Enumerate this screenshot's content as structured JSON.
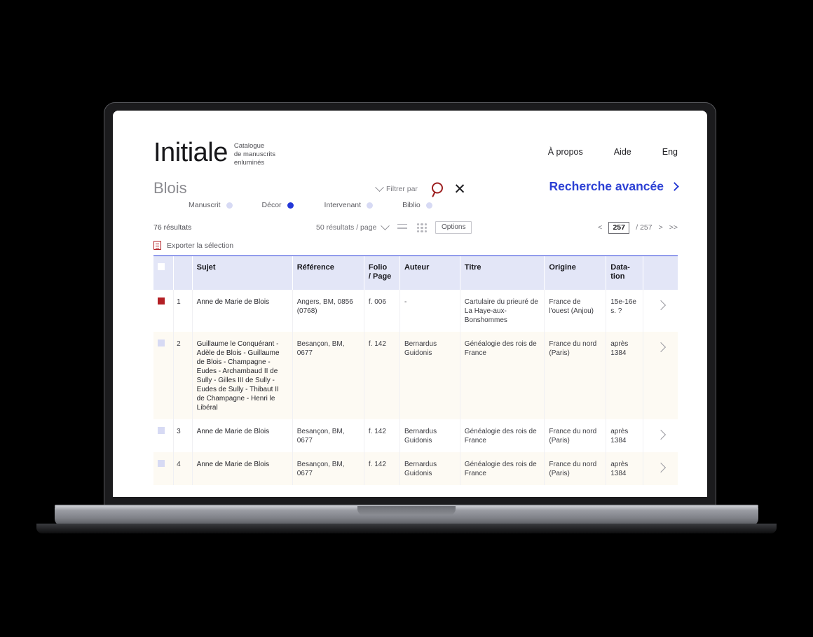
{
  "brand": {
    "name": "Initiale",
    "subtitle_line1": "Catalogue",
    "subtitle_line2": "de manuscrits",
    "subtitle_line3": "enluminés"
  },
  "top_nav": [
    {
      "label": "À propos"
    },
    {
      "label": "Aide"
    },
    {
      "label": "Eng"
    }
  ],
  "search": {
    "query": "Blois",
    "filter_label": "Filtrer par",
    "search_icon": "search-icon",
    "close_icon": "close-icon",
    "advanced_label": "Recherche avancée",
    "advanced_chevron": "chevron-right-icon"
  },
  "facets": [
    {
      "label": "Manuscrit",
      "active": false
    },
    {
      "label": "Décor",
      "active": true
    },
    {
      "label": "Intervenant",
      "active": false
    },
    {
      "label": "Biblio",
      "active": false
    }
  ],
  "toolbar": {
    "result_count": "76 résultats",
    "per_page": "50 résultats / page",
    "per_page_chevron": "chevron-down-icon",
    "list_view_icon": "list-view-icon",
    "grid_view_icon": "grid-view-icon",
    "options_label": "Options",
    "export_label": "Exporter la sélection",
    "export_icon": "export-document-icon"
  },
  "pagination": {
    "prev": "<",
    "current_page": "257",
    "separator": "/ 257",
    "next": ">",
    "last": ">>"
  },
  "table": {
    "columns": [
      {
        "key": "checkbox",
        "label": ""
      },
      {
        "key": "num",
        "label": ""
      },
      {
        "key": "sujet",
        "label": "Sujet"
      },
      {
        "key": "reference",
        "label": "Référence"
      },
      {
        "key": "folio",
        "label": "Folio\n/ Page"
      },
      {
        "key": "auteur",
        "label": "Auteur"
      },
      {
        "key": "titre",
        "label": "Titre"
      },
      {
        "key": "origine",
        "label": "Origine"
      },
      {
        "key": "datation",
        "label": "Data-\ntion"
      },
      {
        "key": "go",
        "label": ""
      }
    ],
    "column_labels": {
      "sujet": "Sujet",
      "reference": "Référence",
      "folio_l1": "Folio",
      "folio_l2": "/ Page",
      "auteur": "Auteur",
      "titre": "Titre",
      "origine": "Origine",
      "datation_l1": "Data-",
      "datation_l2": "tion"
    },
    "rows": [
      {
        "num": "1",
        "marked": true,
        "sujet": "Anne de Marie de Blois",
        "reference": "Angers, BM, 0856 (0768)",
        "folio": "f. 006",
        "auteur": "-",
        "titre": "Cartulaire du prieuré de La Haye-aux-Bonshommes",
        "origine": "France de l'ouest (Anjou)",
        "datation": "15e-16e s. ?"
      },
      {
        "num": "2",
        "marked": false,
        "sujet": "Guillaume le Conquérant - Adèle de Blois - Guillaume de Blois - Champagne - Eudes - Archambaud II de Sully - Gilles III de Sully - Eudes de Sully - Thibaut II de Champagne - Henri le Libéral",
        "reference": "Besançon, BM, 0677",
        "folio": "f. 142",
        "auteur": "Bernardus Guidonis",
        "titre": "Généalogie des rois de France",
        "origine": "France du nord (Paris)",
        "datation": "après 1384"
      },
      {
        "num": "3",
        "marked": false,
        "sujet": "Anne de Marie de Blois",
        "reference": "Besançon, BM, 0677",
        "folio": "f. 142",
        "auteur": "Bernardus Guidonis",
        "titre": "Généalogie des rois de France",
        "origine": "France du nord (Paris)",
        "datation": "après 1384"
      },
      {
        "num": "4",
        "marked": false,
        "sujet": "Anne de Marie de Blois",
        "reference": "Besançon, BM, 0677",
        "folio": "f. 142",
        "auteur": "Bernardus Guidonis",
        "titre": "Généalogie des rois de France",
        "origine": "France du nord (Paris)",
        "datation": "après 1384"
      }
    ]
  },
  "colors": {
    "accent_blue": "#2438d8",
    "header_bg": "#e3e6f7",
    "accent_red": "#b31f24",
    "alt_row": "#fdfaf3"
  }
}
